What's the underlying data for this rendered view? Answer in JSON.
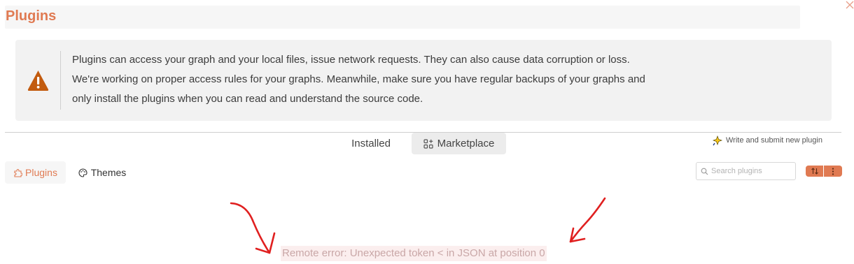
{
  "header": {
    "title": "Plugins"
  },
  "warning": {
    "lines": [
      "Plugins can access your graph and your local files, issue network requests. They can also cause data corruption or loss.",
      "We're working on proper access rules for your graphs. Meanwhile, make sure you have regular backups of your graphs and",
      "only install the plugins when you can read and understand the source code."
    ]
  },
  "tabs": {
    "installed": "Installed",
    "marketplace": "Marketplace",
    "active": "marketplace"
  },
  "submit_link": "Write and submit new plugin",
  "subtabs": {
    "plugins": "Plugins",
    "themes": "Themes",
    "active": "plugins"
  },
  "search": {
    "placeholder": "Search plugins",
    "value": ""
  },
  "error": {
    "message": "Remote error: Unexpected token < in JSON at position 0"
  },
  "colors": {
    "accent": "#e07a52",
    "warning_icon": "#c25b0f",
    "annotation_arrow": "#e02020"
  },
  "icons": {
    "close": "close-icon",
    "warning": "warning-triangle-icon",
    "marketplace": "apps-icon",
    "submit": "sparkle-icon",
    "plugins": "puzzle-icon",
    "themes": "palette-icon",
    "search": "search-icon",
    "sort": "sort-icon",
    "more": "more-vertical-icon"
  }
}
